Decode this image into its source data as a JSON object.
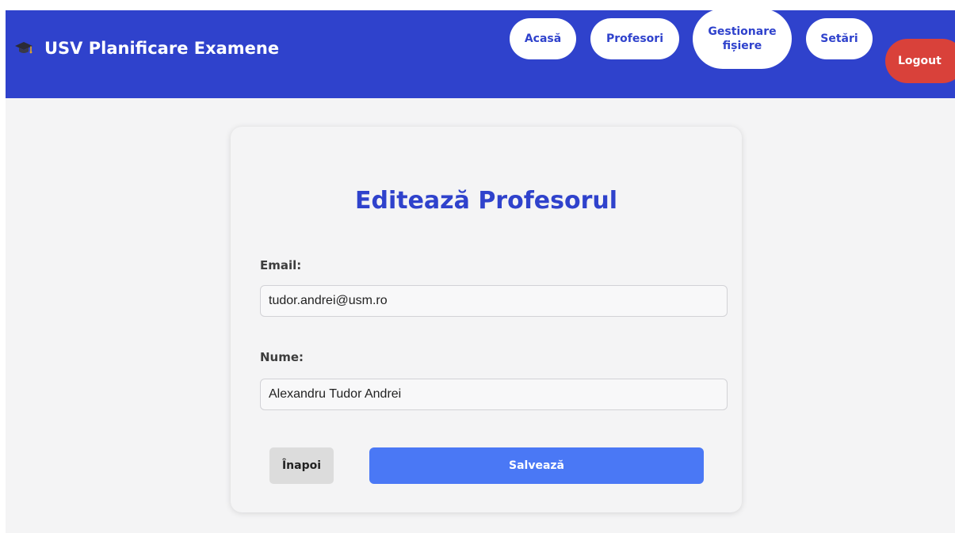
{
  "navbar": {
    "brand_title": "USV Planificare Examene",
    "brand_icon": "graduation-cap-icon",
    "brand_color": "#2f42cc",
    "items": [
      {
        "label": "Acasă"
      },
      {
        "label": "Profesori"
      },
      {
        "label": "Gestionare fișiere"
      },
      {
        "label": "Setări"
      }
    ],
    "logout_label": "Logout",
    "logout_color": "#d9413a"
  },
  "form": {
    "title": "Editează Profesorul",
    "email_label": "Email:",
    "email_value": "tudor.andrei@usm.ro",
    "name_label": "Nume:",
    "name_value": "Alexandru Tudor Andrei",
    "back_label": "Înapoi",
    "save_label": "Salvează",
    "save_color": "#4a78f5"
  }
}
